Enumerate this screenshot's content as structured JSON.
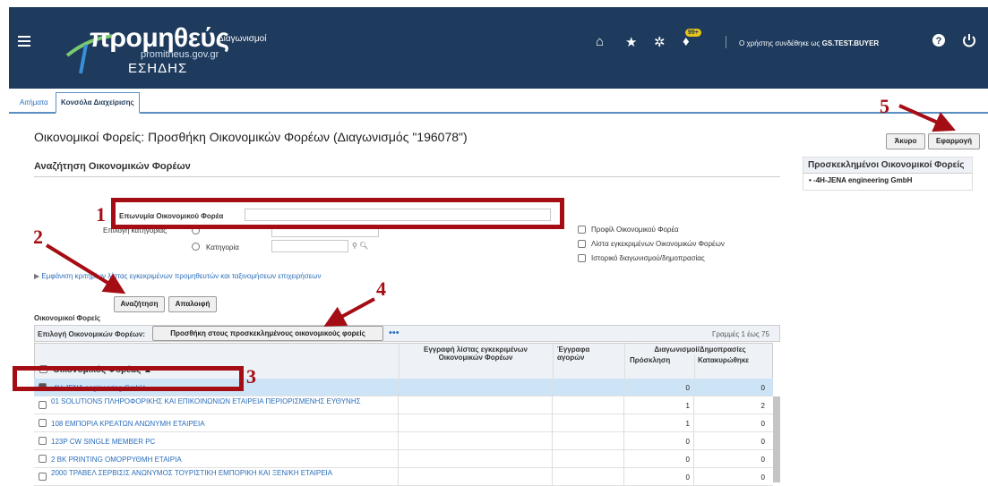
{
  "header": {
    "logo_main": "προμηθεύς",
    "logo_site": "promitheus.gov.gr",
    "logo_system": "ΕΣΗΔΗΣ",
    "module": "Διαγωνισμοί",
    "notification_count": "99+",
    "user_prefix": "Ο χρήστης συνδέθηκε ως",
    "user_name": "GS.TEST.BUYER"
  },
  "tabs": [
    "Αιτήματα",
    "Κονσόλα Διαχείρισης"
  ],
  "page_title": "Οικονομικοί Φορείς: Προσθήκη Οικονομικών Φορέων (Διαγωνισμός \"196078\")",
  "buttons": {
    "cancel": "Άκυρο",
    "apply": "Εφαρμογή",
    "search": "Αναζήτηση",
    "clear": "Απαλοιφή",
    "add_invited": "Προσθήκη στους προσκεκλημένους οικονομικούς φορείς"
  },
  "search_section": {
    "title": "Αναζήτηση Οικονομικών Φορέων",
    "name_label": "Επωνυμία Οικονομικού Φορέα",
    "category_label": "Επιλογή κατηγορίας",
    "radio_category": "Κατηγορία",
    "checkbox_profile": "Προφίλ Οικονομικού Φορέα",
    "checkbox_list": "Λίστα εγκεκριμένων Οικονομικών Φορέων",
    "checkbox_history": "Ιστορικό διαγωνισμού/δημοπρασίας",
    "expand_link": "Εμφάνιση κριτηρίων λίστας εγκεκριμένων προμηθευτών και ταξινομήσεων επιχειρήσεων"
  },
  "invited_panel": {
    "title": "Προσκεκλημένοι Οικονομικοί Φορείς",
    "items": [
      "-4H-JENA engineering GmbH"
    ]
  },
  "results": {
    "section_label": "Οικονομικοί Φορείς",
    "select_label": "Επιλογή Οικονομικών Φορέων:",
    "more": "•••",
    "rows_info": "Γραμμές 1 έως 75",
    "columns": {
      "name": "Οικονομικός Φορέας ▲",
      "approved_list": "Εγγραφή λίστας εγκεκριμένων Οικονομικών Φορέων",
      "market_docs": "Έγγραφα αγορών",
      "tenders_group": "Διαγωνισμοί/Δημοπρασίες",
      "invitation": "Πρόσκληση",
      "awarded": "Κατακυρώθηκε"
    },
    "rows": [
      {
        "name": "-4H-JENA engineering GmbH",
        "invitation": "0",
        "awarded": "0",
        "checked": true
      },
      {
        "name": "01 SOLUTIONS ΠΛΗΡΟΦΟΡΙΚΗΣ ΚΑΙ ΕΠΙΚΟΙΝΩΝΙΩΝ ΕΤΑΙΡΕΙΑ ΠΕΡΙΟΡΙΣΜΕΝΗΣ ΕΥΘΥΝΗΣ",
        "invitation": "1",
        "awarded": "2",
        "checked": false
      },
      {
        "name": "108 ΕΜΠΟΡΙΑ ΚΡΕΑΤΩΝ ΑΝΩΝΥΜΗ ΕΤΑΙΡΕΙΑ",
        "invitation": "1",
        "awarded": "0",
        "checked": false
      },
      {
        "name": "123P CW SINGLE MEMBER PC",
        "invitation": "0",
        "awarded": "0",
        "checked": false
      },
      {
        "name": "2 BK PRINTING ΟΜΟΡΡΥΘΜΗ ΕΤΑΙΡΙΑ",
        "invitation": "0",
        "awarded": "0",
        "checked": false
      },
      {
        "name": "2000 ΤΡΑΒΕΛ ΣΕΡΒΙΣΙΣ ΑΝΩΝΥΜΟΣ ΤΟΥΡΙΣΤΙΚΗ ΕΜΠΟΡΙΚΗ ΚΑΙ ΞΕΝ/ΚΗ ΕΤΑΙΡΕΙΑ",
        "invitation": "0",
        "awarded": "0",
        "checked": false
      }
    ]
  },
  "annotations": [
    "1",
    "2",
    "3",
    "4",
    "5"
  ],
  "colors": {
    "header_bg": "#1e3a5c",
    "annotation": "#a50d14",
    "link": "#2a6ebb",
    "selected_row": "#cde4f7"
  }
}
